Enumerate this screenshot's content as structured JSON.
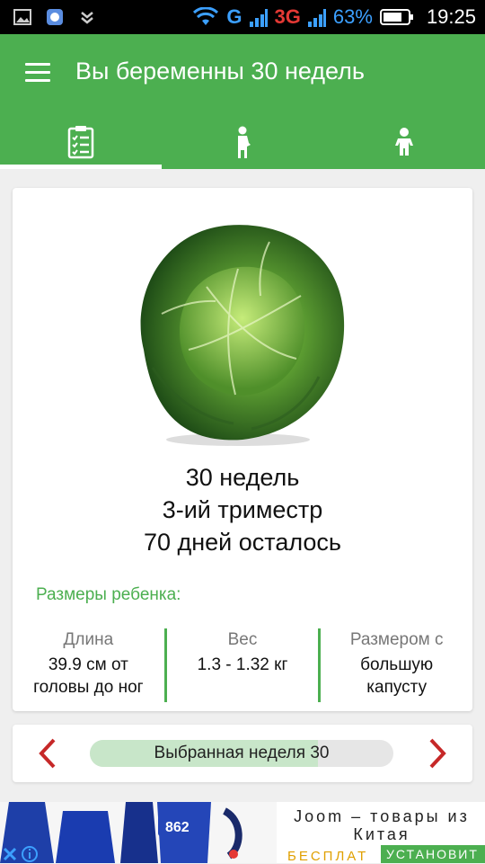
{
  "status_bar": {
    "network_g": "G",
    "network_3g": "3G",
    "battery_percent": "63%",
    "time": "19:25"
  },
  "app_bar": {
    "title": "Вы беременны 30 недель"
  },
  "tabs": [
    {
      "icon": "checklist-icon",
      "active": true
    },
    {
      "icon": "pregnant-woman-icon",
      "active": false
    },
    {
      "icon": "baby-icon",
      "active": false
    }
  ],
  "week_info": {
    "weeks": "30 недель",
    "trimester": "3-ий триместр",
    "days_left": "70 дней осталось",
    "image": "cabbage"
  },
  "baby_sizes": {
    "title": "Размеры ребенка:",
    "length_label": "Длина",
    "length_value": "39.9 см от головы до ног",
    "weight_label": "Вес",
    "weight_value": "1.3 - 1.32 кг",
    "size_label": "Размером с",
    "size_value": "большую капусту"
  },
  "week_selector": {
    "label": "Выбранная неделя 30",
    "progress": 0.75,
    "prev_icon": "chevron-left-icon",
    "next_icon": "chevron-right-icon"
  },
  "ad": {
    "headline": "Joom – товары из Китая",
    "cta_free": "БЕСПЛАТ",
    "cta_install": "УСТАНОВИТ",
    "price_badge": "862"
  },
  "colors": {
    "primary": "#4caf50",
    "arrow": "#c62828"
  }
}
